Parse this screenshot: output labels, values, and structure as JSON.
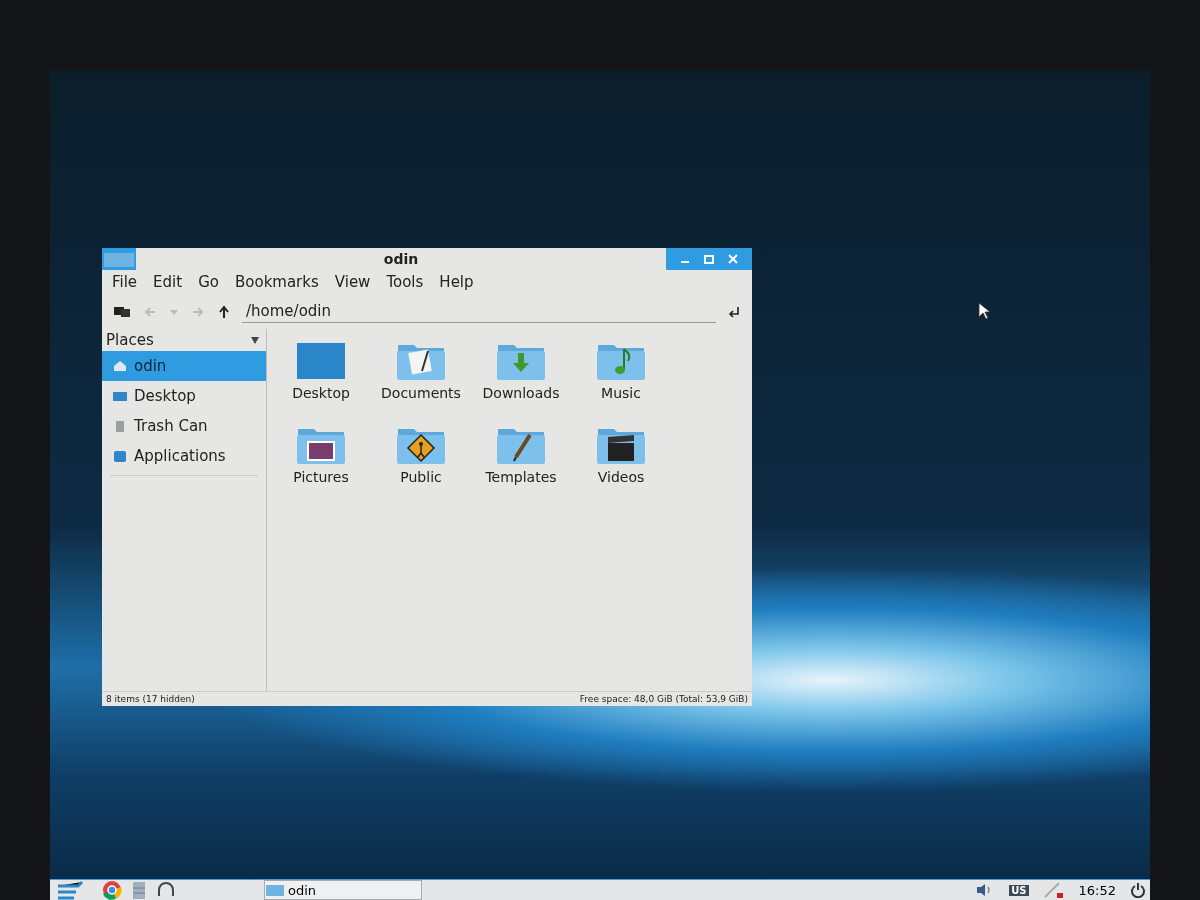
{
  "window": {
    "title": "odin",
    "menu": [
      "File",
      "Edit",
      "Go",
      "Bookmarks",
      "View",
      "Tools",
      "Help"
    ],
    "location": "/home/odin",
    "sidebar": {
      "title": "Places",
      "items": [
        {
          "label": "odin",
          "kind": "home",
          "selected": true
        },
        {
          "label": "Desktop",
          "kind": "desktop",
          "selected": false
        },
        {
          "label": "Trash Can",
          "kind": "trash",
          "selected": false
        },
        {
          "label": "Applications",
          "kind": "apps",
          "selected": false
        }
      ]
    },
    "files": [
      {
        "name": "Desktop",
        "kind": "desktop"
      },
      {
        "name": "Documents",
        "kind": "documents"
      },
      {
        "name": "Downloads",
        "kind": "downloads"
      },
      {
        "name": "Music",
        "kind": "music"
      },
      {
        "name": "Pictures",
        "kind": "pictures"
      },
      {
        "name": "Public",
        "kind": "public"
      },
      {
        "name": "Templates",
        "kind": "templates"
      },
      {
        "name": "Videos",
        "kind": "videos"
      }
    ],
    "status_bar": {
      "left": "8 items (17 hidden)",
      "right": "Free space: 48,0 GiB (Total: 53,9 GiB)"
    }
  },
  "taskbar": {
    "task": "odin",
    "keyboard_layout": "US",
    "clock": "16:52"
  }
}
